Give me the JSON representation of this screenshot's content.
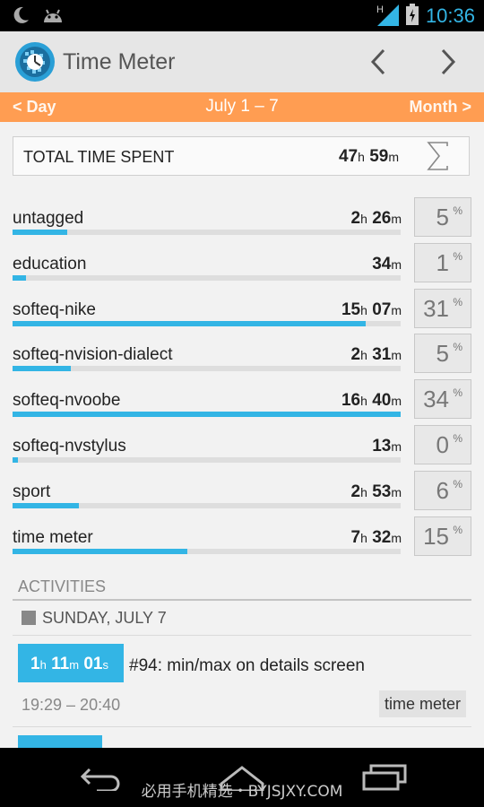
{
  "status_bar": {
    "time": "10:36",
    "left_icons": [
      "moon-icon",
      "android-icon"
    ],
    "network": "H",
    "colors": {
      "time": "#33b5e5"
    }
  },
  "action_bar": {
    "title": "Time Meter",
    "icons": [
      "app-clock-icon",
      "chevron-left-icon",
      "chevron-right-icon"
    ]
  },
  "period_bar": {
    "prev_label": "< Day",
    "current_label": "July 1 – 7",
    "next_label": "Month >",
    "color": "#ff9d52"
  },
  "total": {
    "label": "TOTAL TIME SPENT",
    "hours": "47",
    "minutes": "59",
    "hour_unit": "h",
    "minute_unit": "m",
    "icon": "sigma-icon"
  },
  "categories": [
    {
      "name": "untagged",
      "hours": "2",
      "minutes": "26",
      "percent": "5",
      "fill": 0.14
    },
    {
      "name": "education",
      "hours": "",
      "minutes": "34",
      "percent": "1",
      "fill": 0.035
    },
    {
      "name": "softeq-nike",
      "hours": "15",
      "minutes": "07",
      "percent": "31",
      "fill": 0.91
    },
    {
      "name": "softeq-nvision-dialect",
      "hours": "2",
      "minutes": "31",
      "percent": "5",
      "fill": 0.15
    },
    {
      "name": "softeq-nvoobe",
      "hours": "16",
      "minutes": "40",
      "percent": "34",
      "fill": 1.0
    },
    {
      "name": "softeq-nvstylus",
      "hours": "",
      "minutes": "13",
      "percent": "0",
      "fill": 0.013
    },
    {
      "name": "sport",
      "hours": "2",
      "minutes": "53",
      "percent": "6",
      "fill": 0.17
    },
    {
      "name": "time meter",
      "hours": "7",
      "minutes": "32",
      "percent": "15",
      "fill": 0.45
    }
  ],
  "units": {
    "hour": "h",
    "minute": "m",
    "second": "s",
    "percent": "%"
  },
  "activities": {
    "header": "ACTIVITIES",
    "day_label": "SUNDAY, JULY 7",
    "items": [
      {
        "duration_h": "1",
        "duration_m": "11",
        "duration_s": "01",
        "title": "#94: min/max on details screen",
        "time_range": "19:29 – 20:40",
        "tag": "time meter"
      }
    ]
  },
  "nav_bar": {
    "icons": [
      "back-icon",
      "home-icon",
      "recent-apps-icon"
    ],
    "watermark": "必用手机精选・BYJSJXY.COM"
  },
  "colors": {
    "accent": "#33b5e5",
    "orange": "#ff9d52"
  }
}
